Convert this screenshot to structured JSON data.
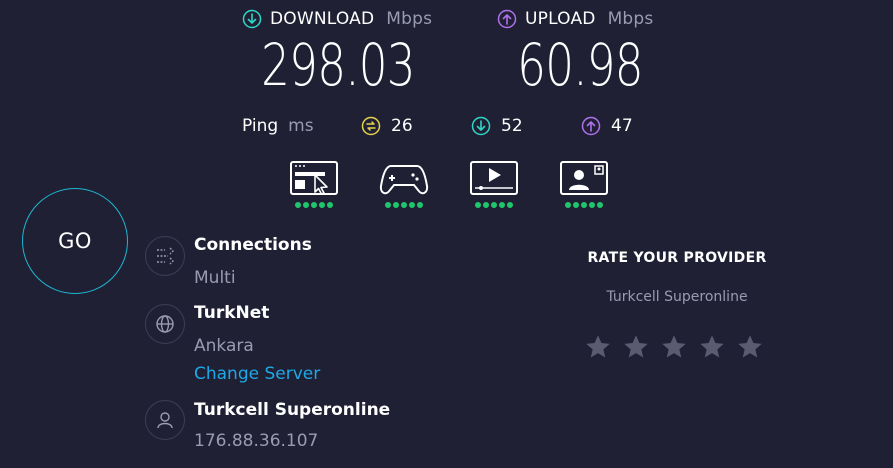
{
  "download": {
    "label": "DOWNLOAD",
    "unit": "Mbps",
    "value": "298.03",
    "icon": "download-icon",
    "color": "#2ed6c6"
  },
  "upload": {
    "label": "UPLOAD",
    "unit": "Mbps",
    "value": "60.98",
    "icon": "upload-icon",
    "color": "#b070ec"
  },
  "ping": {
    "label": "Ping",
    "unit": "ms",
    "idle": {
      "value": "26",
      "icon": "idle-latency-icon",
      "color": "#e3d24a"
    },
    "download": {
      "value": "52",
      "icon": "download-latency-icon",
      "color": "#2ed6c6"
    },
    "upload": {
      "value": "47",
      "icon": "upload-latency-icon",
      "color": "#b070ec"
    }
  },
  "activities": [
    {
      "icon": "web-browsing-icon",
      "rating": 5
    },
    {
      "icon": "gaming-icon",
      "rating": 5
    },
    {
      "icon": "video-streaming-icon",
      "rating": 5
    },
    {
      "icon": "video-chat-icon",
      "rating": 5
    }
  ],
  "go_button": {
    "label": "GO"
  },
  "connections": {
    "title": "Connections",
    "value": "Multi",
    "icon": "connections-icon"
  },
  "server": {
    "title": "TurkNet",
    "location": "Ankara",
    "change_label": "Change Server",
    "icon": "globe-icon"
  },
  "provider": {
    "title": "Turkcell Superonline",
    "ip": "176.88.36.107",
    "icon": "user-icon"
  },
  "rate": {
    "title": "RATE YOUR PROVIDER",
    "provider": "Turkcell Superonline",
    "stars": 5,
    "star_color": "#5a5b70"
  }
}
